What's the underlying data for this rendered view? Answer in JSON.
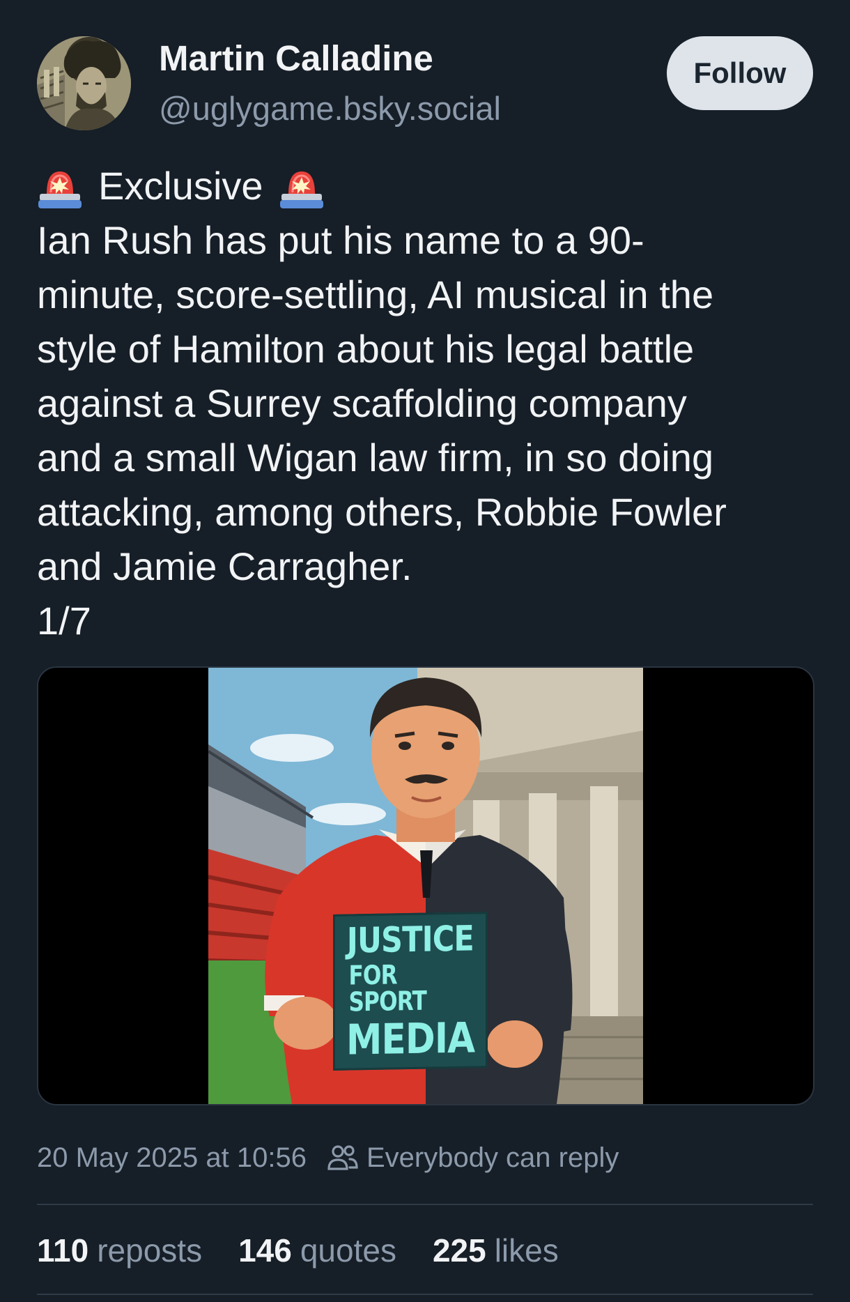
{
  "author": {
    "name": "Martin Calladine",
    "handle": "@uglygame.bsky.social"
  },
  "follow_button": {
    "label": "Follow"
  },
  "post": {
    "headline": "Exclusive",
    "headline_icon": "police-car-light-icon",
    "body_lines": [
      "Ian Rush has put his name to a 90-",
      "minute, score-settling, AI musical in the",
      "style of Hamilton about his legal battle",
      "against a Surrey scaffolding company",
      "and a small Wigan law firm, in so doing",
      "attacking, among others, Robbie Fowler",
      "and Jamie Carragher.",
      "1/7"
    ]
  },
  "media": {
    "sign_text": [
      "JUSTICE",
      "FOR SPORT",
      "MEDIA"
    ]
  },
  "meta": {
    "timestamp": "20 May 2025 at 10:56",
    "reply_setting": "Everybody can reply",
    "reply_icon": "people-icon"
  },
  "stats": {
    "reposts": {
      "count": "110",
      "label": "reposts"
    },
    "quotes": {
      "count": "146",
      "label": "quotes"
    },
    "likes": {
      "count": "225",
      "label": "likes"
    }
  },
  "colors": {
    "background": "#161e27",
    "text_primary": "#f1f3f5",
    "text_secondary": "#8c9aab",
    "follow_button_bg": "#dfe4ea"
  }
}
